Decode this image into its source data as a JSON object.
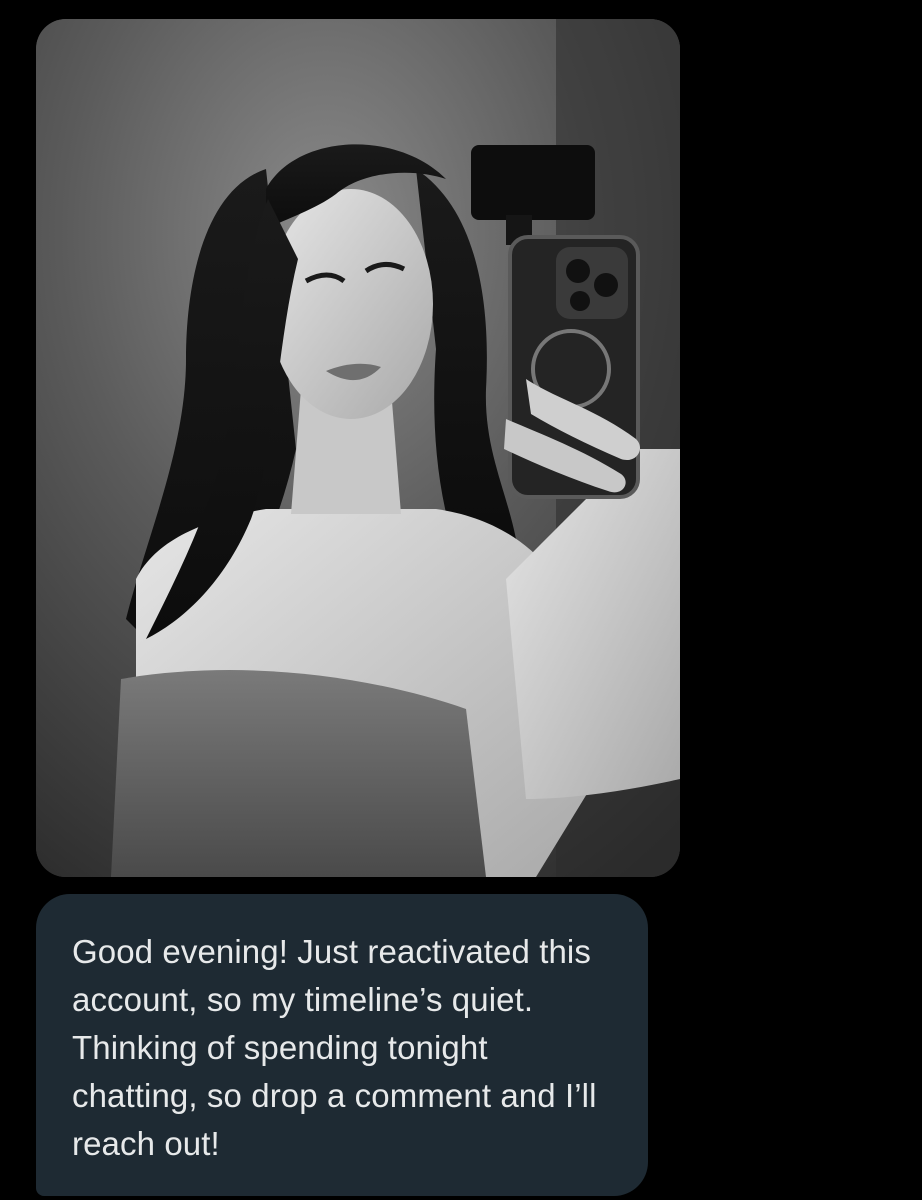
{
  "conversation": {
    "attachment": {
      "kind": "image",
      "icon": "photo-icon",
      "style": "black-and-white"
    },
    "message": {
      "text": "Good evening! Just reactivated this account, so my timeline’s quiet. Thinking of spending tonight chatting, so drop a comment and I’ll reach out!"
    }
  },
  "colors": {
    "background": "#000000",
    "bubble": "#1e2a33",
    "message_text": "#e7e9ea"
  }
}
